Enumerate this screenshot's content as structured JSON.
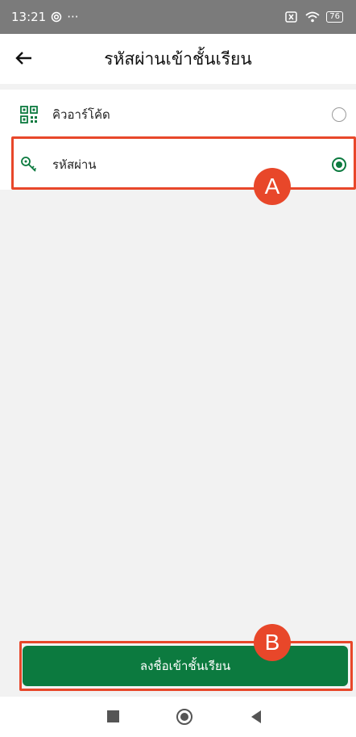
{
  "status_bar": {
    "time": "13:21",
    "extra": "···",
    "battery": "76",
    "icons": [
      "at-sign-icon",
      "close-box-icon",
      "wifi-icon",
      "battery-icon"
    ]
  },
  "header": {
    "title": "รหัสผ่านเข้าชั้นเรียน",
    "back_icon": "arrow-left-icon"
  },
  "options": [
    {
      "label": "คิวอาร์โค้ด",
      "icon": "qr-code-icon",
      "selected": false
    },
    {
      "label": "รหัสผ่าน",
      "icon": "key-icon",
      "selected": true
    }
  ],
  "annotations": {
    "a": "A",
    "b": "B"
  },
  "cta": {
    "label": "ลงชื่อเข้าชั้นเรียน"
  },
  "nav": {
    "icons": [
      "recents-square-icon",
      "home-circle-icon",
      "back-triangle-icon"
    ]
  },
  "colors": {
    "primary": "#0c7a3f",
    "annotation": "#e8472a",
    "status_bar": "#7b7b7b"
  }
}
